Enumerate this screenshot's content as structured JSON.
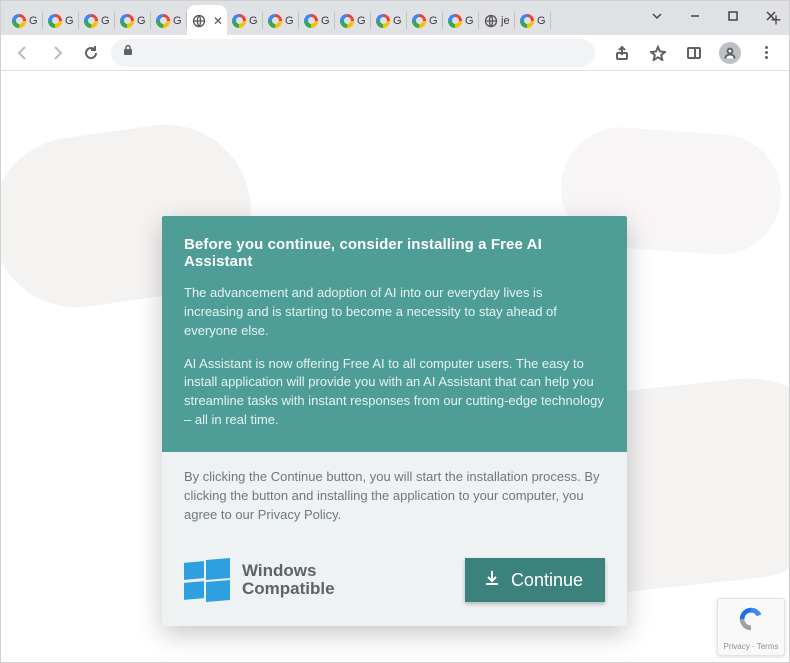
{
  "window": {
    "controls": {
      "minimize": "–",
      "maximize": "▢",
      "close": "✕"
    }
  },
  "tabs": {
    "items": [
      {
        "kind": "google",
        "label": "G"
      },
      {
        "kind": "google",
        "label": "G"
      },
      {
        "kind": "google",
        "label": "G"
      },
      {
        "kind": "google",
        "label": "G"
      },
      {
        "kind": "google",
        "label": "G"
      },
      {
        "kind": "globe",
        "label": "",
        "active": true
      },
      {
        "kind": "google",
        "label": "G"
      },
      {
        "kind": "google",
        "label": "G"
      },
      {
        "kind": "google",
        "label": "G"
      },
      {
        "kind": "google",
        "label": "G"
      },
      {
        "kind": "google",
        "label": "G"
      },
      {
        "kind": "google",
        "label": "G"
      },
      {
        "kind": "google",
        "label": "G"
      },
      {
        "kind": "globe",
        "label": "je"
      },
      {
        "kind": "google",
        "label": "G"
      }
    ],
    "newtab": "+"
  },
  "toolbar": {
    "address": ""
  },
  "dialog": {
    "title": "Before you continue, consider installing a Free AI Assistant",
    "p1": "The advancement and adoption of AI into our everyday lives is increasing and is starting to become a necessity to stay ahead of everyone else.",
    "p2": "AI Assistant is now offering Free AI to all computer users. The easy to install application will provide you with an AI Assistant that can help you streamline tasks with instant responses from our cutting-edge technology – all in real time.",
    "disclaimer": "By clicking the Continue button, you will start the installation process. By clicking the button and installing the application to your computer, you agree to our Privacy Policy.",
    "compat1": "Windows",
    "compat2": "Compatible",
    "continue": "Continue"
  },
  "recaptcha": {
    "line": "Privacy · Terms"
  }
}
